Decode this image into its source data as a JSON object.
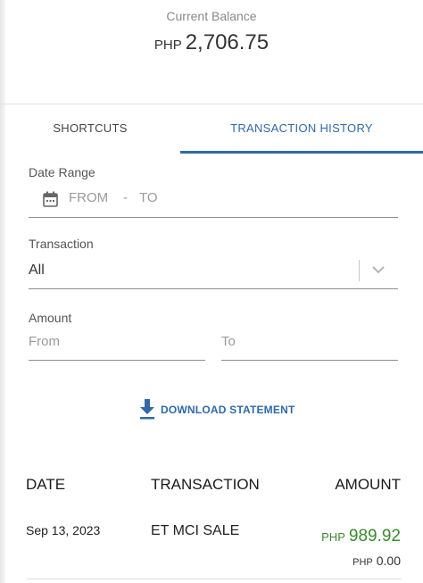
{
  "balance": {
    "label": "Current Balance",
    "currency": "PHP",
    "amount": "2,706.75"
  },
  "tabs": {
    "shortcuts": "SHORTCUTS",
    "history": "TRANSACTION HISTORY",
    "active": "history"
  },
  "filters": {
    "date_range": {
      "label": "Date Range",
      "from": "FROM",
      "separator": "-",
      "to": "TO"
    },
    "transaction": {
      "label": "Transaction",
      "selected": "All"
    },
    "amount": {
      "label": "Amount",
      "from_placeholder": "From",
      "to_placeholder": "To"
    }
  },
  "download": {
    "label": "DOWNLOAD STATEMENT",
    "icon": "download-icon"
  },
  "table": {
    "headers": {
      "date": "DATE",
      "transaction": "TRANSACTION",
      "amount": "AMOUNT"
    },
    "rows": [
      {
        "date": "Sep 13, 2023",
        "transaction": "ET MCI SALE",
        "amount_currency": "PHP",
        "amount": "989.92",
        "fee_currency": "PHP",
        "fee": "0.00"
      }
    ]
  },
  "colors": {
    "accent": "#3069a6",
    "positive_amount": "#3a8a2e",
    "muted_text": "#8a8a8a"
  }
}
